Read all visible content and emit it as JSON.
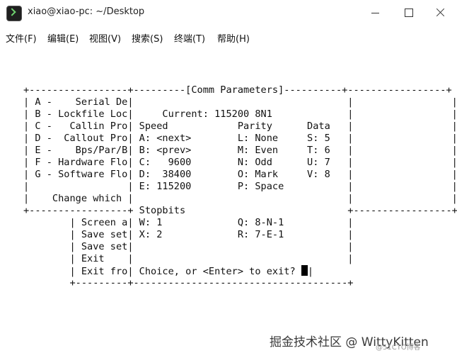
{
  "window": {
    "title": "xiao@xiao-pc: ~/Desktop",
    "icon": "terminal-icon"
  },
  "menu": {
    "items": [
      "文件(F)",
      "编辑(E)",
      "视图(V)",
      "搜索(S)",
      "终端(T)",
      "帮助(H)"
    ]
  },
  "terminal": {
    "lines": [
      "+-----------------+---------[Comm Parameters]----------+-----------------+",
      "| A -    Serial De|                                     |                 |",
      "| B - Lockfile Loc|     Current: 115200 8N1             |                 |",
      "| C -   Callin Pro| Speed            Parity      Data   |                 |",
      "| D -  Callout Pro| A: <next>        L: None     S: 5   |                 |",
      "| E -    Bps/Par/B| B: <prev>        M: Even     T: 6   |                 |",
      "| F - Hardware Flo| C:   9600        N: Odd      U: 7   |                 |",
      "| G - Software Flo| D:  38400        O: Mark     V: 8   |                 |",
      "|                 | E: 115200        P: Space           |                 |",
      "|    Change which |                                     |                 |",
      "+-----------------+ Stopbits                            +-----------------+",
      "        | Screen a| W: 1             Q: 8-N-1           |",
      "        | Save set| X: 2             R: 7-E-1           |",
      "        | Save set|                                     |",
      "        | Exit    |                                     |",
      "        | Exit fro| Choice, or <Enter> to exit? ",
      "        +---------+-------------------------------------+"
    ],
    "prompt_tail": "|"
  },
  "watermark": {
    "text": "掘金技术社区 @ WittyKitten",
    "small": "@51CTO博客"
  }
}
